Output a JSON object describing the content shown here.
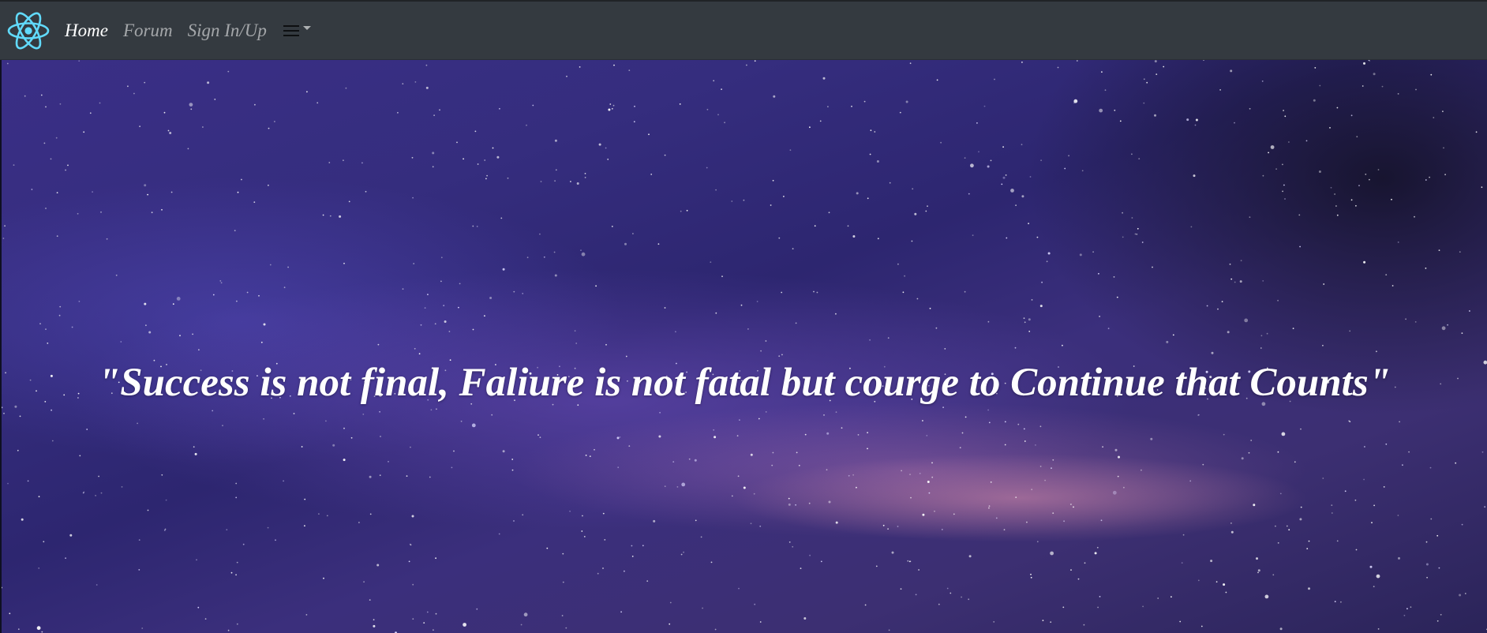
{
  "navbar": {
    "logo_icon": "react-atom-icon",
    "logo_color": "#61dafb",
    "links": [
      {
        "label": "Home",
        "active": true
      },
      {
        "label": "Forum",
        "active": false
      },
      {
        "label": "Sign In/Up",
        "active": false
      }
    ],
    "menu_icon": "hamburger-icon",
    "background": "#343a40"
  },
  "hero": {
    "quote": "\"Success is not final, Faliure is not fatal but courge to Continue that Counts\"",
    "background_theme": "starry-night-sky"
  }
}
